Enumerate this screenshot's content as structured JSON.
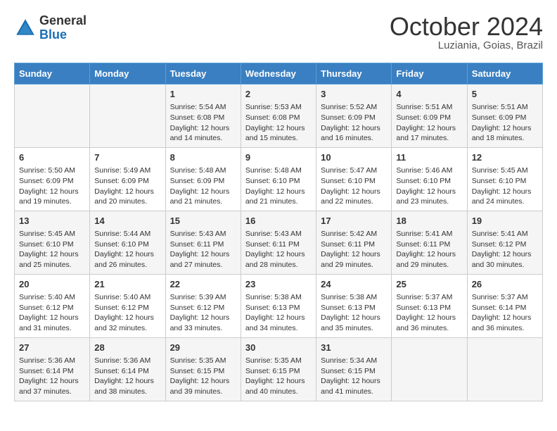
{
  "header": {
    "logo_general": "General",
    "logo_blue": "Blue",
    "month_title": "October 2024",
    "location": "Luziania, Goias, Brazil"
  },
  "calendar": {
    "days_of_week": [
      "Sunday",
      "Monday",
      "Tuesday",
      "Wednesday",
      "Thursday",
      "Friday",
      "Saturday"
    ],
    "weeks": [
      [
        {
          "day": "",
          "info": ""
        },
        {
          "day": "",
          "info": ""
        },
        {
          "day": "1",
          "info": "Sunrise: 5:54 AM\nSunset: 6:08 PM\nDaylight: 12 hours and 14 minutes."
        },
        {
          "day": "2",
          "info": "Sunrise: 5:53 AM\nSunset: 6:08 PM\nDaylight: 12 hours and 15 minutes."
        },
        {
          "day": "3",
          "info": "Sunrise: 5:52 AM\nSunset: 6:09 PM\nDaylight: 12 hours and 16 minutes."
        },
        {
          "day": "4",
          "info": "Sunrise: 5:51 AM\nSunset: 6:09 PM\nDaylight: 12 hours and 17 minutes."
        },
        {
          "day": "5",
          "info": "Sunrise: 5:51 AM\nSunset: 6:09 PM\nDaylight: 12 hours and 18 minutes."
        }
      ],
      [
        {
          "day": "6",
          "info": "Sunrise: 5:50 AM\nSunset: 6:09 PM\nDaylight: 12 hours and 19 minutes."
        },
        {
          "day": "7",
          "info": "Sunrise: 5:49 AM\nSunset: 6:09 PM\nDaylight: 12 hours and 20 minutes."
        },
        {
          "day": "8",
          "info": "Sunrise: 5:48 AM\nSunset: 6:09 PM\nDaylight: 12 hours and 21 minutes."
        },
        {
          "day": "9",
          "info": "Sunrise: 5:48 AM\nSunset: 6:10 PM\nDaylight: 12 hours and 21 minutes."
        },
        {
          "day": "10",
          "info": "Sunrise: 5:47 AM\nSunset: 6:10 PM\nDaylight: 12 hours and 22 minutes."
        },
        {
          "day": "11",
          "info": "Sunrise: 5:46 AM\nSunset: 6:10 PM\nDaylight: 12 hours and 23 minutes."
        },
        {
          "day": "12",
          "info": "Sunrise: 5:45 AM\nSunset: 6:10 PM\nDaylight: 12 hours and 24 minutes."
        }
      ],
      [
        {
          "day": "13",
          "info": "Sunrise: 5:45 AM\nSunset: 6:10 PM\nDaylight: 12 hours and 25 minutes."
        },
        {
          "day": "14",
          "info": "Sunrise: 5:44 AM\nSunset: 6:10 PM\nDaylight: 12 hours and 26 minutes."
        },
        {
          "day": "15",
          "info": "Sunrise: 5:43 AM\nSunset: 6:11 PM\nDaylight: 12 hours and 27 minutes."
        },
        {
          "day": "16",
          "info": "Sunrise: 5:43 AM\nSunset: 6:11 PM\nDaylight: 12 hours and 28 minutes."
        },
        {
          "day": "17",
          "info": "Sunrise: 5:42 AM\nSunset: 6:11 PM\nDaylight: 12 hours and 29 minutes."
        },
        {
          "day": "18",
          "info": "Sunrise: 5:41 AM\nSunset: 6:11 PM\nDaylight: 12 hours and 29 minutes."
        },
        {
          "day": "19",
          "info": "Sunrise: 5:41 AM\nSunset: 6:12 PM\nDaylight: 12 hours and 30 minutes."
        }
      ],
      [
        {
          "day": "20",
          "info": "Sunrise: 5:40 AM\nSunset: 6:12 PM\nDaylight: 12 hours and 31 minutes."
        },
        {
          "day": "21",
          "info": "Sunrise: 5:40 AM\nSunset: 6:12 PM\nDaylight: 12 hours and 32 minutes."
        },
        {
          "day": "22",
          "info": "Sunrise: 5:39 AM\nSunset: 6:12 PM\nDaylight: 12 hours and 33 minutes."
        },
        {
          "day": "23",
          "info": "Sunrise: 5:38 AM\nSunset: 6:13 PM\nDaylight: 12 hours and 34 minutes."
        },
        {
          "day": "24",
          "info": "Sunrise: 5:38 AM\nSunset: 6:13 PM\nDaylight: 12 hours and 35 minutes."
        },
        {
          "day": "25",
          "info": "Sunrise: 5:37 AM\nSunset: 6:13 PM\nDaylight: 12 hours and 36 minutes."
        },
        {
          "day": "26",
          "info": "Sunrise: 5:37 AM\nSunset: 6:14 PM\nDaylight: 12 hours and 36 minutes."
        }
      ],
      [
        {
          "day": "27",
          "info": "Sunrise: 5:36 AM\nSunset: 6:14 PM\nDaylight: 12 hours and 37 minutes."
        },
        {
          "day": "28",
          "info": "Sunrise: 5:36 AM\nSunset: 6:14 PM\nDaylight: 12 hours and 38 minutes."
        },
        {
          "day": "29",
          "info": "Sunrise: 5:35 AM\nSunset: 6:15 PM\nDaylight: 12 hours and 39 minutes."
        },
        {
          "day": "30",
          "info": "Sunrise: 5:35 AM\nSunset: 6:15 PM\nDaylight: 12 hours and 40 minutes."
        },
        {
          "day": "31",
          "info": "Sunrise: 5:34 AM\nSunset: 6:15 PM\nDaylight: 12 hours and 41 minutes."
        },
        {
          "day": "",
          "info": ""
        },
        {
          "day": "",
          "info": ""
        }
      ]
    ]
  }
}
